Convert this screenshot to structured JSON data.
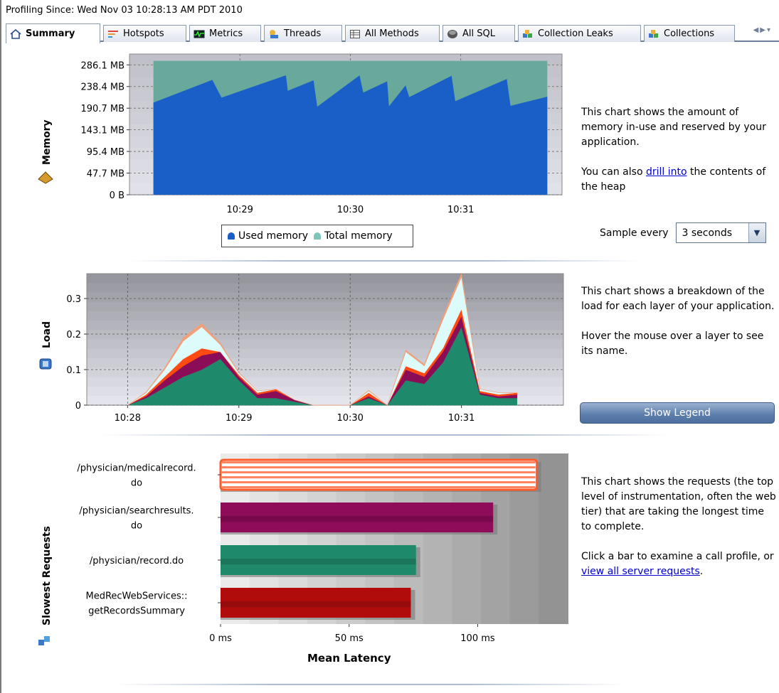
{
  "header": {
    "profiling_since": "Profiling Since: Wed Nov 03 10:28:13 AM PDT 2010"
  },
  "tabs": [
    {
      "label": "Summary",
      "icon": "house-icon",
      "active": true
    },
    {
      "label": "Hotspots",
      "icon": "hotspots-icon"
    },
    {
      "label": "Metrics",
      "icon": "metrics-icon"
    },
    {
      "label": "Threads",
      "icon": "threads-icon"
    },
    {
      "label": "All Methods",
      "icon": "methods-icon"
    },
    {
      "label": "All SQL",
      "icon": "database-icon"
    },
    {
      "label": "Collection Leaks",
      "icon": "collection-leaks-icon"
    },
    {
      "label": "Collections",
      "icon": "collections-icon"
    }
  ],
  "memory": {
    "section_title": "Memory",
    "description_1": "This chart shows the amount of memory in-use and reserved by your application.",
    "description_2_before": "You can also ",
    "description_2_link": "drill into",
    "description_2_after": " the contents of the heap",
    "legend": {
      "used": "Used memory",
      "total": "Total memory"
    },
    "sample_label": "Sample every",
    "sample_value": "3 seconds"
  },
  "load": {
    "section_title": "Load",
    "description_1": "This chart shows a breakdown of the load for each layer of your application.",
    "description_2": "Hover the mouse over a layer to see its name.",
    "show_legend_label": "Show Legend"
  },
  "requests": {
    "section_title": "Slowest Requests",
    "description_1": "This chart shows the requests (the top level of instrumentation, often the web tier) that are taking the longest time to complete.",
    "description_2_before": "Click a bar to examine a call profile, or ",
    "description_2_link": "view all server requests",
    "description_2_after": "."
  },
  "chart_data": [
    {
      "type": "area",
      "name": "memory",
      "x_ticks": [
        "10:29",
        "10:30",
        "10:31"
      ],
      "y_ticks": [
        "286.1 MB",
        "238.4 MB",
        "190.7 MB",
        "143.1 MB",
        "95.4 MB",
        "47.7 MB",
        "0 B"
      ],
      "ylim_mb": [
        0,
        310
      ],
      "x": [
        "10:28:13",
        "10:28:45",
        "10:28:50",
        "10:29:25",
        "10:29:26",
        "10:29:40",
        "10:29:42",
        "10:30:05",
        "10:30:07",
        "10:30:20",
        "10:30:21",
        "10:30:30",
        "10:30:32",
        "10:30:55",
        "10:30:57",
        "10:31:25",
        "10:31:27",
        "10:31:47"
      ],
      "series": [
        {
          "name": "Used memory",
          "color": "#1a5fc8",
          "values": [
            203,
            253,
            214,
            263,
            229,
            252,
            194,
            263,
            225,
            250,
            195,
            241,
            215,
            262,
            206,
            255,
            196,
            216
          ]
        },
        {
          "name": "Total memory",
          "color": "#68a99c",
          "values": [
            295,
            295,
            295,
            295,
            295,
            295,
            295,
            295,
            295,
            295,
            295,
            295,
            295,
            295,
            295,
            295,
            295,
            295
          ]
        }
      ]
    },
    {
      "type": "area",
      "name": "load",
      "x_ticks": [
        "10:28",
        "10:29",
        "10:30",
        "10:31"
      ],
      "y_ticks": [
        "0.3",
        "0.2",
        "0.1",
        "0"
      ],
      "ylim": [
        0,
        0.37
      ],
      "x": [
        "10:28:00",
        "10:28:10",
        "10:28:20",
        "10:28:30",
        "10:28:40",
        "10:28:50",
        "10:29:00",
        "10:29:10",
        "10:29:20",
        "10:29:30",
        "10:29:40",
        "10:29:50",
        "10:30:00",
        "10:30:10",
        "10:30:20",
        "10:30:30",
        "10:30:40",
        "10:30:50",
        "10:31:00",
        "10:31:10",
        "10:31:20",
        "10:31:30"
      ],
      "series": [
        {
          "color": "#1f8a6b",
          "values": [
            0,
            0.02,
            0.05,
            0.08,
            0.1,
            0.13,
            0.07,
            0.02,
            0.02,
            0.01,
            0,
            0,
            0,
            0.02,
            0,
            0.07,
            0.06,
            0.12,
            0.22,
            0.03,
            0.02,
            0.02,
            0
          ]
        },
        {
          "color": "#8b0d58",
          "values": [
            0,
            0.005,
            0.02,
            0.03,
            0.04,
            0.02,
            0.01,
            0.01,
            0.02,
            0.005,
            0,
            0,
            0,
            0.005,
            0,
            0.03,
            0.02,
            0.03,
            0.03,
            0.005,
            0.005,
            0.01,
            0
          ]
        },
        {
          "color": "#ff4a12",
          "values": [
            0,
            0.005,
            0.01,
            0.02,
            0.02,
            0,
            0.005,
            0.005,
            0.005,
            0,
            0,
            0,
            0,
            0.01,
            0,
            0.01,
            0.01,
            0.01,
            0.02,
            0.005,
            0.005,
            0.005,
            0
          ]
        },
        {
          "color": "#ddfbfb",
          "values": [
            0,
            0.005,
            0.02,
            0.05,
            0.06,
            0.02,
            0.005,
            0.005,
            0,
            0,
            0,
            0,
            0,
            0.005,
            0,
            0.04,
            0.02,
            0.08,
            0.09,
            0.005,
            0.005,
            0,
            0
          ]
        },
        {
          "color": "#f0a07a",
          "values": [
            0,
            0.002,
            0.005,
            0.01,
            0.01,
            0.005,
            0.002,
            0,
            0,
            0,
            0,
            0,
            0,
            0.002,
            0,
            0.005,
            0.005,
            0.01,
            0.01,
            0,
            0,
            0,
            0
          ]
        }
      ]
    },
    {
      "type": "bar",
      "name": "slowest_requests",
      "orientation": "horizontal",
      "xlabel": "Mean Latency",
      "x_ticks": [
        "0 ms",
        "50 ms",
        "100 ms"
      ],
      "xlim": [
        0,
        135
      ],
      "categories": [
        "/physician/medicalrecord.do",
        "/physician/searchresults.do",
        "/physician/record.do",
        "MedRecWebServices::getRecordsSummary"
      ],
      "category_lines": [
        [
          "/physician/medicalrecord.",
          "do"
        ],
        [
          "/physician/searchresults.",
          "do"
        ],
        [
          "/physician/record.do"
        ],
        [
          "MedRecWebServices::",
          "getRecordsSummary"
        ]
      ],
      "values": [
        123,
        106,
        76,
        74
      ],
      "colors": [
        "#ff5a28",
        "#8e0c5a",
        "#1f8a6b",
        "#b00c0c"
      ]
    }
  ]
}
